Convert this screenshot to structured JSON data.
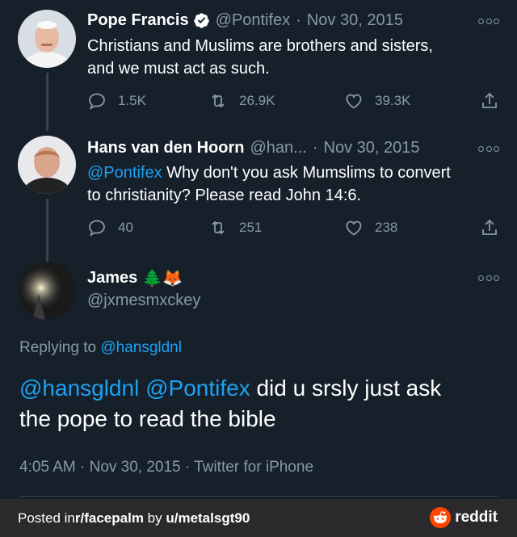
{
  "tweets": [
    {
      "name": "Pope Francis",
      "handle": "@Pontifex",
      "date": "Nov 30, 2015",
      "text_line1": "Christians and Muslims are brothers and sisters,",
      "text_line2": "and we must act as such.",
      "replies": "1.5K",
      "retweets": "26.9K",
      "likes": "39.3K"
    },
    {
      "name": "Hans van den Hoorn",
      "handle": "@han...",
      "date": "Nov 30, 2015",
      "mention": "@Pontifex",
      "text_line1": " Why don't you ask Mumslims to convert",
      "text_line2": "to christianity? Please read John 14:6.",
      "replies": "40",
      "retweets": "251",
      "likes": "238"
    }
  ],
  "main_tweet": {
    "name": "James",
    "emoji": "🌲🦊",
    "handle": "@jxmesmxckey",
    "replying_prefix": "Replying to ",
    "replying_to": "@hansgldnl",
    "mention1": "@hansgldnl",
    "mention2": "@Pontifex",
    "text_rest": " did u srsly just ask",
    "text_line2": "the pope to read the bible",
    "timestamp": "4:05 AM · Nov 30, 2015 · Twitter for iPhone"
  },
  "footer": {
    "posted_in": "Posted in ",
    "subreddit": "r/facepalm",
    "by": " by ",
    "user": "u/metalsgt90",
    "brand": "reddit"
  },
  "colors": {
    "background": "#15202b",
    "link": "#1da1f2",
    "muted": "#8899a6",
    "footer_bg": "#2a2a2c",
    "reddit_orange": "#ff4500"
  }
}
